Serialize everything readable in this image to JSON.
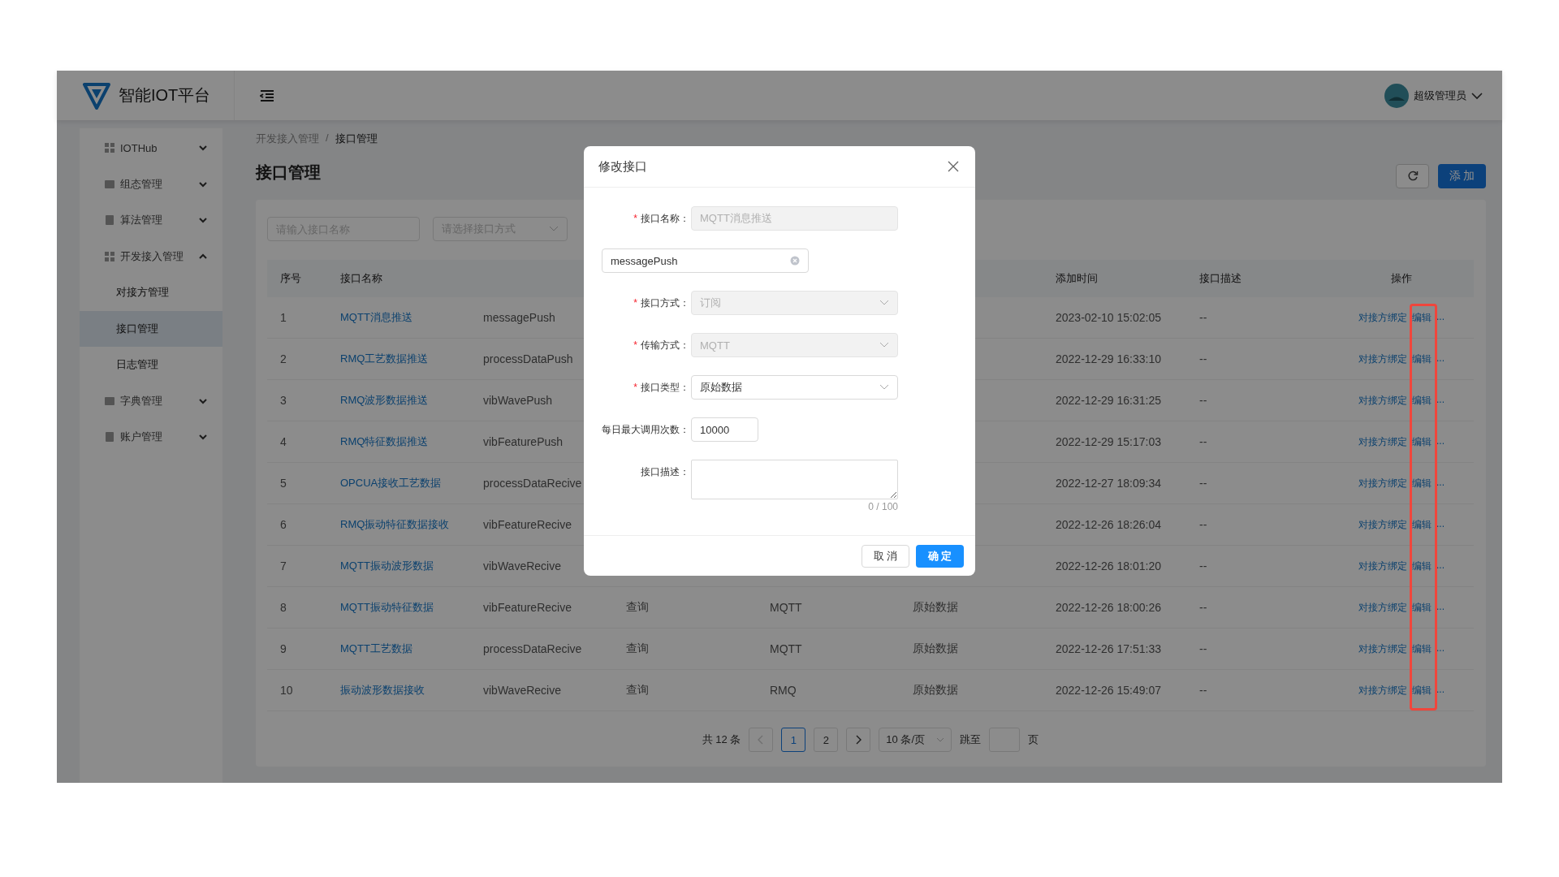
{
  "header": {
    "logo_text": "智能IOT平台",
    "user_name": "超级管理员"
  },
  "sidebar": {
    "items": [
      {
        "label": "IOTHub",
        "expanded": false
      },
      {
        "label": "组态管理",
        "expanded": false
      },
      {
        "label": "算法管理",
        "expanded": false
      },
      {
        "label": "开发接入管理",
        "expanded": true,
        "children": [
          {
            "label": "对接方管理",
            "selected": false
          },
          {
            "label": "接口管理",
            "selected": true
          },
          {
            "label": "日志管理",
            "selected": false
          }
        ]
      },
      {
        "label": "字典管理",
        "expanded": false
      },
      {
        "label": "账户管理",
        "expanded": false
      }
    ]
  },
  "breadcrumb": {
    "separator": "/",
    "items": [
      "开发接入管理",
      "接口管理"
    ]
  },
  "title": "接口管理",
  "toolbar": {
    "add_label": "添 加"
  },
  "filters": [
    {
      "kind": "input",
      "placeholder": "请输入接口名称"
    },
    {
      "kind": "select",
      "placeholder": "请选择接口方式"
    }
  ],
  "table": {
    "edit_column_highlighted": true,
    "columns": [
      {
        "label": "序号"
      },
      {
        "label": "接口名称"
      },
      {},
      {},
      {},
      {},
      {
        "label": "添加时间"
      },
      {
        "label": "接口描述"
      },
      {
        "label": "操作"
      }
    ],
    "rows": [
      {
        "no": "1",
        "name": "MQTT消息推送",
        "column_3": "messagePush",
        "added": "2023-02-10 15:02:05",
        "description": "--",
        "actions": [
          "对接方绑定",
          "编辑",
          "..."
        ]
      },
      {
        "no": "2",
        "name": "RMQ工艺数据推送",
        "column_3": "processDataPush",
        "added": "2022-12-29 16:33:10",
        "description": "--",
        "actions": [
          "对接方绑定",
          "编辑",
          "..."
        ]
      },
      {
        "no": "3",
        "name": "RMQ波形数据推送",
        "column_3": "vibWavePush",
        "added": "2022-12-29 16:31:25",
        "description": "--",
        "actions": [
          "对接方绑定",
          "编辑",
          "..."
        ]
      },
      {
        "no": "4",
        "name": "RMQ特征数据推送",
        "column_3": "vibFeaturePush",
        "added": "2022-12-29 15:17:03",
        "description": "--",
        "actions": [
          "对接方绑定",
          "编辑",
          "..."
        ]
      },
      {
        "no": "5",
        "name": "OPCUA接收工艺数据",
        "column_3": "processDataRecive",
        "added": "2022-12-27 18:09:34",
        "description": "--",
        "actions": [
          "对接方绑定",
          "编辑",
          "..."
        ]
      },
      {
        "no": "6",
        "name": "RMQ振动特征数据接收",
        "column_3": "vibFeatureRecive",
        "added": "2022-12-26 18:26:04",
        "description": "--",
        "actions": [
          "对接方绑定",
          "编辑",
          "..."
        ]
      },
      {
        "no": "7",
        "name": "MQTT振动波形数据",
        "column_3": "vibWaveRecive",
        "added": "2022-12-26 18:01:20",
        "description": "--",
        "actions": [
          "对接方绑定",
          "编辑",
          "..."
        ]
      },
      {
        "no": "8",
        "name": "MQTT振动特征数据",
        "column_3": "vibFeatureRecive",
        "column_4": "查询",
        "column_5": "MQTT",
        "column_6": "原始数据",
        "added": "2022-12-26 18:00:26",
        "description": "--",
        "actions": [
          "对接方绑定",
          "编辑",
          "..."
        ]
      },
      {
        "no": "9",
        "name": "MQTT工艺数据",
        "column_3": "processDataRecive",
        "column_4": "查询",
        "column_5": "MQTT",
        "column_6": "原始数据",
        "added": "2022-12-26 17:51:33",
        "description": "--",
        "actions": [
          "对接方绑定",
          "编辑",
          "..."
        ]
      },
      {
        "no": "10",
        "name": "振动波形数据接收",
        "column_3": "vibWaveRecive",
        "column_4": "查询",
        "column_5": "RMQ",
        "column_6": "原始数据",
        "added": "2022-12-26 15:49:07",
        "description": "--",
        "actions": [
          "对接方绑定",
          "编辑",
          "..."
        ]
      }
    ]
  },
  "pagination": {
    "total": "共 12 条",
    "prev_disabled": true,
    "pages": [
      {
        "label": "1",
        "selected": true
      },
      {
        "label": "2",
        "selected": false
      }
    ],
    "page_size": "10 条/页",
    "jump_label": "跳至",
    "jump_unit": "页"
  },
  "dialog": {
    "title": "修改接口",
    "required_mark": "*",
    "fields": [
      {
        "kind": "input",
        "label": "接口名称：",
        "required": true,
        "value": "MQTT消息推送",
        "disabled": true
      },
      {
        "kind": "input",
        "value": "messagePush",
        "clearable": true,
        "disabled": false
      },
      {
        "kind": "select",
        "label": "接口方式：",
        "required": true,
        "value": "订阅",
        "disabled": true
      },
      {
        "kind": "select",
        "label": "传输方式：",
        "required": true,
        "value": "MQTT",
        "disabled": true
      },
      {
        "kind": "select",
        "label": "接口类型：",
        "required": true,
        "value": "原始数据",
        "disabled": false
      },
      {
        "kind": "number",
        "label": "每日最大调用次数：",
        "value": "10000",
        "disabled": false
      },
      {
        "kind": "textarea",
        "label": "接口描述：",
        "counter": "0 / 100"
      }
    ],
    "buttons": [
      {
        "label": "取 消",
        "kind": "default"
      },
      {
        "label": "确 定",
        "kind": "primary"
      }
    ]
  }
}
